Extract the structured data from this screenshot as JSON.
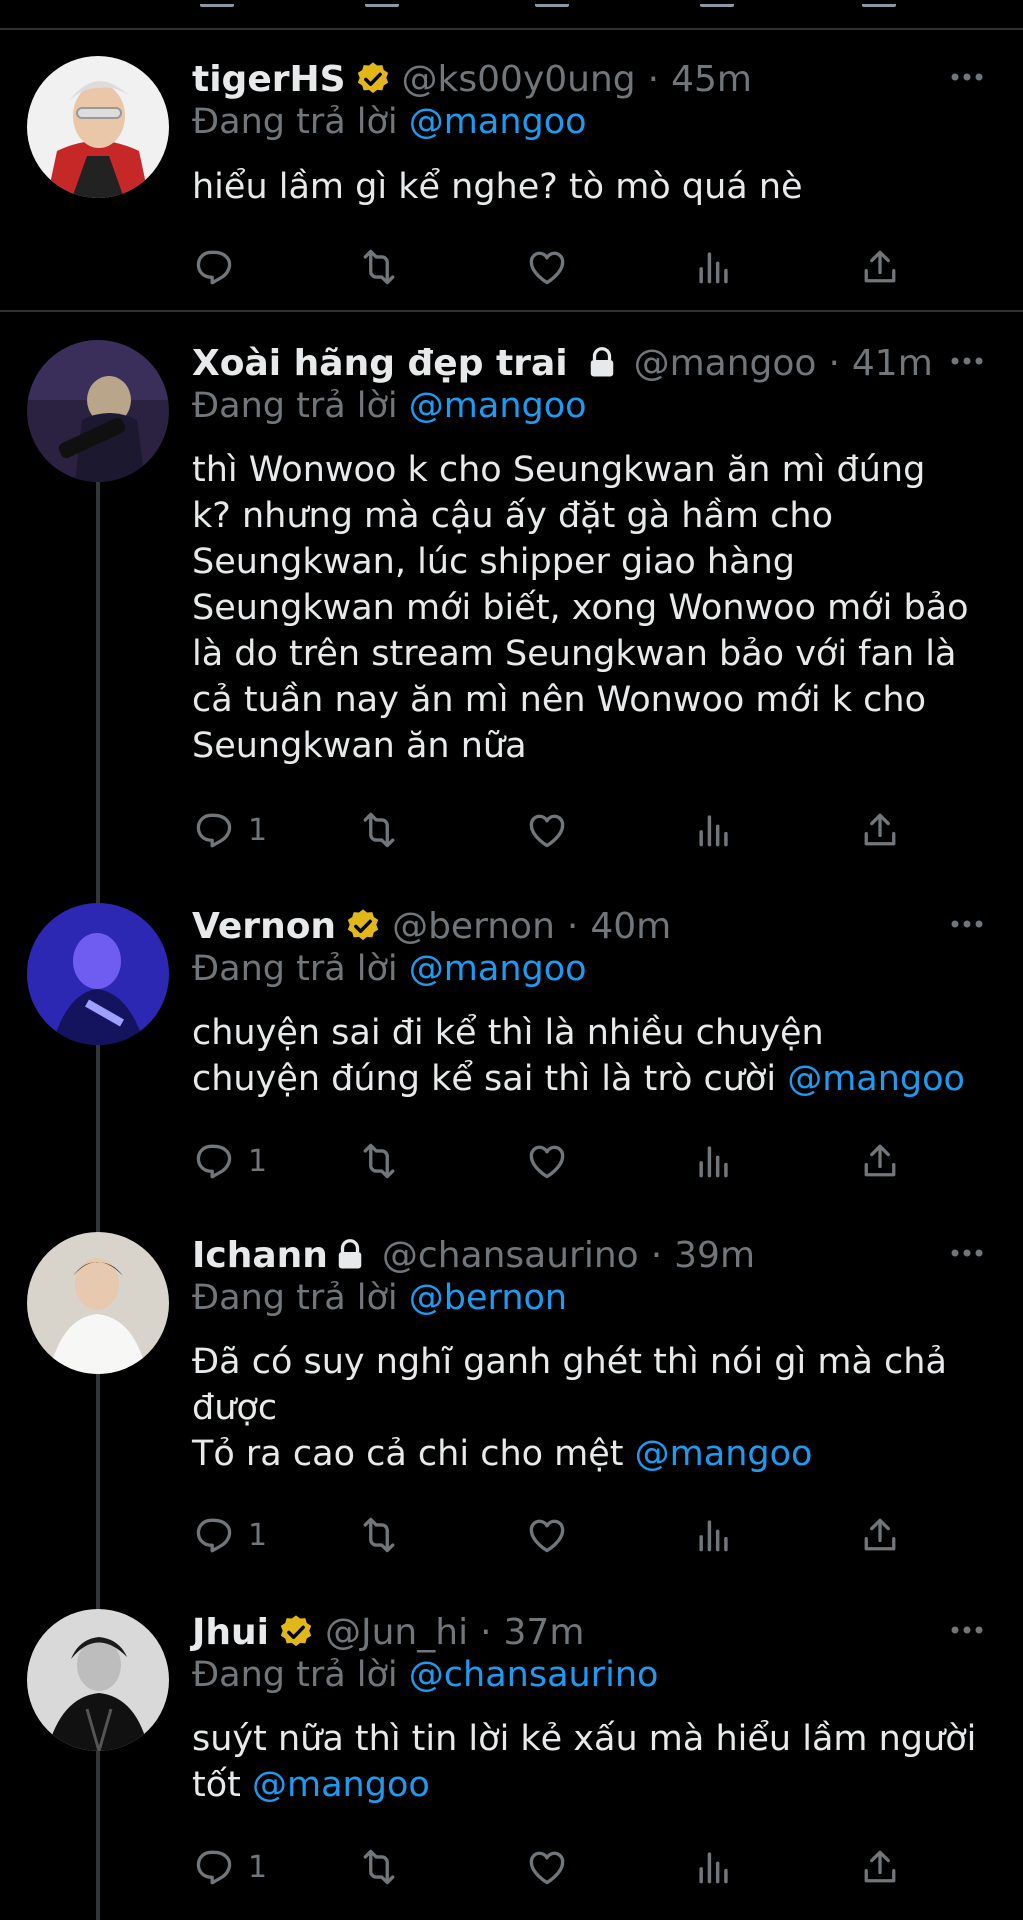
{
  "reply_prefix": "Đang trả lời",
  "tweets": [
    {
      "name": "tigerHS",
      "verified": true,
      "protected": false,
      "handle": "@ks00y0ung",
      "time": "45m",
      "reply_to": "@mangoo",
      "lines": [
        "hiểu lầm gì kể nghe? tò mò quá nè"
      ],
      "trailing_mention": "",
      "reply_count": ""
    },
    {
      "name": "Xoài hãng đẹp trai",
      "verified": false,
      "protected": true,
      "handle": "@mangoo",
      "time": "41m",
      "reply_to": "@mangoo",
      "lines": [
        "thì Wonwoo k cho Seungkwan ăn mì đúng",
        "k? nhưng mà cậu ấy đặt gà hầm cho",
        "Seungkwan, lúc shipper giao hàng",
        "Seungkwan mới biết, xong Wonwoo mới bảo",
        "là do trên stream Seungkwan bảo với fan là",
        "cả tuần nay ăn mì nên Wonwoo mới k cho",
        "Seungkwan ăn nữa"
      ],
      "trailing_mention": "",
      "reply_count": "1"
    },
    {
      "name": "Vernon",
      "verified": true,
      "protected": false,
      "handle": "@bernon",
      "time": "40m",
      "reply_to": "@mangoo",
      "lines": [
        "chuyện sai đi kể thì là nhiều chuyện",
        "chuyện đúng kể sai thì là trò cười"
      ],
      "trailing_mention": "@mangoo",
      "reply_count": "1"
    },
    {
      "name": "Ichann",
      "verified": false,
      "protected": true,
      "handle": "@chansaurino",
      "time": "39m",
      "reply_to": "@bernon",
      "lines": [
        "Đã có suy nghĩ ganh ghét thì nói gì mà chả",
        "được",
        "Tỏ ra cao cả chi cho mệt"
      ],
      "trailing_mention": "@mangoo",
      "reply_count": "1"
    },
    {
      "name": "Jhui",
      "verified": true,
      "protected": false,
      "handle": "@Jun_hi",
      "time": "37m",
      "reply_to": "@chansaurino",
      "lines": [
        "suýt nữa thì tin lời kẻ xấu mà hiểu lầm người",
        "tốt"
      ],
      "trailing_mention": "@mangoo",
      "reply_count": "1"
    }
  ],
  "icons": {
    "reply": "reply-icon",
    "retweet": "retweet-icon",
    "like": "like-icon",
    "views": "views-icon",
    "share": "share-icon",
    "verified": "verified-badge-icon",
    "protected": "lock-icon",
    "more": "more-icon"
  },
  "colors": {
    "background": "#000000",
    "text": "#e7e9ea",
    "secondary": "#71767b",
    "link": "#1d9bf0",
    "verified_gold": "#e2b719",
    "separator": "#2f3336"
  }
}
